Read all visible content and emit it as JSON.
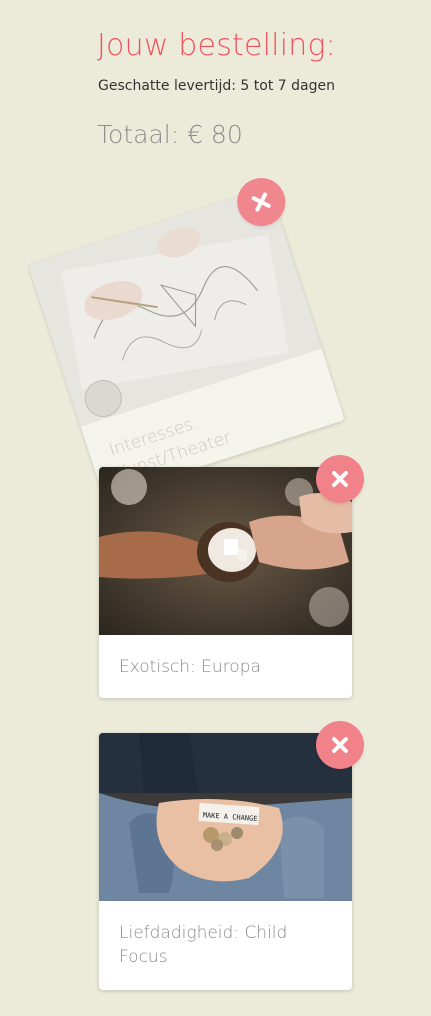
{
  "header": {
    "title": "Jouw bestelling:",
    "delivery": "Geschatte levertijd: 5 tot 7 dagen",
    "total": "Totaal: € 80"
  },
  "items": [
    {
      "label": "Interesses: Kunst/Theater",
      "image": "sketching-hands-photo"
    },
    {
      "label": "Exotisch: Europa",
      "image": "coconut-hands-photo"
    },
    {
      "label": "Liefdadigheid: Child Focus",
      "image": "make-a-change-coins-photo"
    }
  ],
  "colors": {
    "background": "#ecead9",
    "accent": "#f0535f",
    "remove_button": "#f2828a"
  },
  "icons": {
    "remove": "close-icon"
  }
}
